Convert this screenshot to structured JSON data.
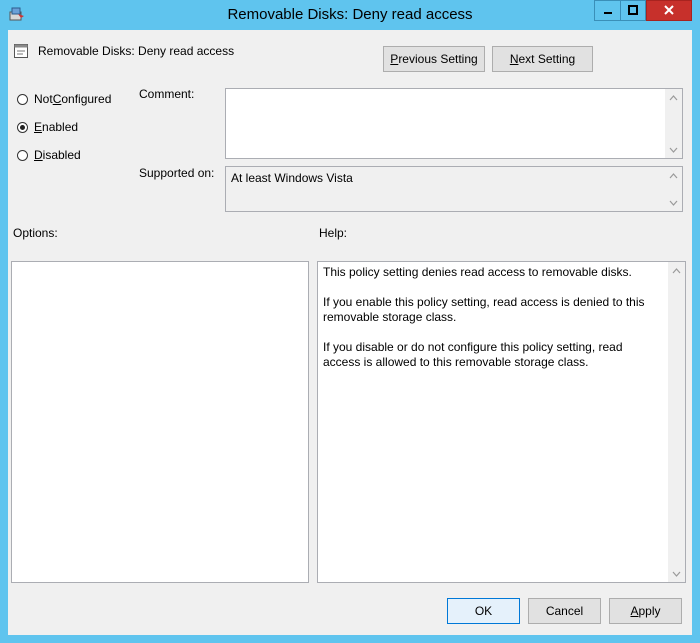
{
  "window": {
    "title": "Removable Disks: Deny read access"
  },
  "header": {
    "setting_name": "Removable Disks: Deny read access",
    "previous_button": {
      "accel": "P",
      "rest": "revious Setting"
    },
    "next_button": {
      "accel": "N",
      "rest": "ext Setting"
    }
  },
  "state_options": [
    {
      "pre": "Not ",
      "accel": "C",
      "post": "onfigured",
      "selected": false
    },
    {
      "pre": "",
      "accel": "E",
      "post": "nabled",
      "selected": true
    },
    {
      "pre": "",
      "accel": "D",
      "post": "isabled",
      "selected": false
    }
  ],
  "comment": {
    "label": "Comment:",
    "value": ""
  },
  "supported_on": {
    "label": "Supported on:",
    "value": "At least Windows Vista"
  },
  "options": {
    "label": "Options:"
  },
  "help": {
    "label": "Help:",
    "paragraphs": [
      "This policy setting denies read access to removable disks.",
      "If you enable this policy setting, read access is denied to this removable storage class.",
      "If you disable or do not configure this policy setting, read access is allowed to this removable storage class."
    ]
  },
  "footer": {
    "ok_label": "OK",
    "cancel_label": "Cancel",
    "apply_button": {
      "accel": "A",
      "rest": "pply"
    }
  },
  "colors": {
    "title_bar": "#5fc4ee",
    "close_button": "#c7302b",
    "dialog_bg": "#f0f0f0"
  }
}
